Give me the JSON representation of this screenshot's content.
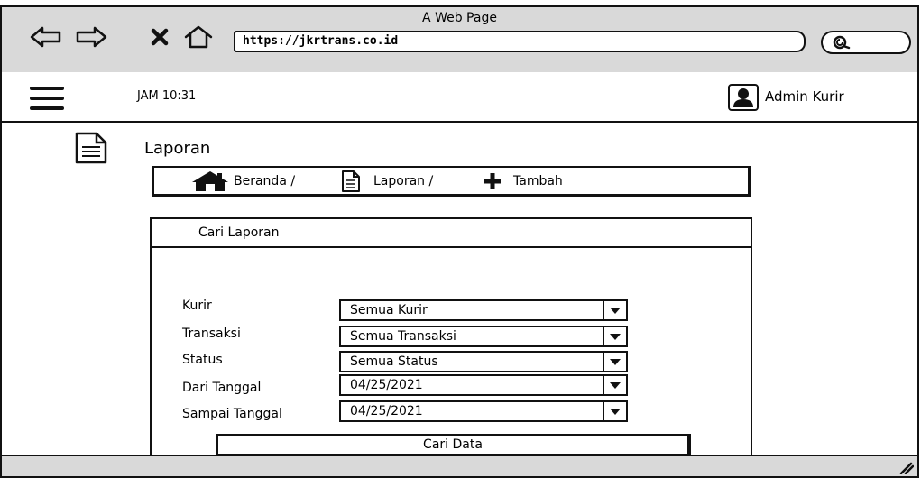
{
  "browser": {
    "title": "A Web Page",
    "url": "https://jkrtrans.co.id",
    "icons": [
      "back-arrow-icon",
      "forward-arrow-icon",
      "close-icon",
      "home-icon",
      "search-icon"
    ]
  },
  "header": {
    "clock": "JAM 10:31",
    "user": "Admin Kurir"
  },
  "page": {
    "title": "Laporan"
  },
  "breadcrumb": [
    {
      "label": "Beranda /",
      "icon": "home-icon"
    },
    {
      "label": "Laporan /",
      "icon": "document-icon"
    },
    {
      "label": "Tambah",
      "icon": "plus-icon"
    }
  ],
  "search_panel": {
    "title": "Cari Laporan",
    "fields": [
      {
        "label": "Kurir",
        "value": "Semua Kurir"
      },
      {
        "label": "Transaksi",
        "value": "Semua Transaksi"
      },
      {
        "label": "Status",
        "value": "Semua Status"
      },
      {
        "label": "Dari Tanggal",
        "value": "04/25/2021"
      },
      {
        "label": "Sampai Tanggal",
        "value": "04/25/2021"
      }
    ],
    "submit_label": "Cari Data"
  },
  "colors": {
    "chrome": "#d9d9d9",
    "ink": "#111111"
  }
}
